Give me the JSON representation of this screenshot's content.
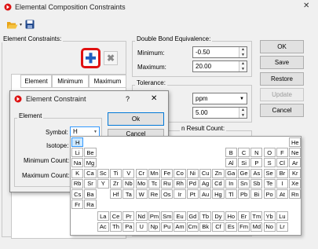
{
  "main_window": {
    "title": "Elemental Composition Constraints",
    "toolbar": {
      "open_icon": "folder-open-icon",
      "save_icon": "floppy-disk-icon"
    },
    "element_constraints": {
      "label": "Element Constraints:",
      "add_icon": "plus-icon",
      "remove_icon": "x-icon",
      "highlight_color": "#e01010",
      "columns": [
        "Element",
        "Minimum",
        "Maximum"
      ]
    },
    "dbe": {
      "label": "Double Bond Equivalence:",
      "min_label": "Minimum:",
      "min_value": "-0.50",
      "max_label": "Maximum:",
      "max_value": "20.00"
    },
    "tolerance": {
      "label": "Tolerance:",
      "unit": "ppm",
      "value": "5.00"
    },
    "result_count": {
      "label_partial": "n Result Count:"
    },
    "buttons": {
      "ok": "OK",
      "save": "Save",
      "restore": "Restore",
      "update": "Update",
      "cancel": "Cancel"
    }
  },
  "dialog": {
    "title": "Element Constraint",
    "help": "?",
    "close": "✕",
    "group_label": "Element",
    "symbol_label": "Symbol:",
    "symbol_value": "H",
    "isotope_label": "Isotope:",
    "min_count_label": "Minimum Count:",
    "max_count_label": "Maximum Count:",
    "ok_label": "Ok",
    "cancel_label": "Cancel"
  },
  "periodic_table": {
    "selected": "H",
    "rows": [
      [
        "H",
        "",
        "",
        "",
        "",
        "",
        "",
        "",
        "",
        "",
        "",
        "",
        "",
        "",
        "",
        "",
        "",
        "He"
      ],
      [
        "Li",
        "Be",
        "",
        "",
        "",
        "",
        "",
        "",
        "",
        "",
        "",
        "",
        "B",
        "C",
        "N",
        "O",
        "F",
        "Ne"
      ],
      [
        "Na",
        "Mg",
        "",
        "",
        "",
        "",
        "",
        "",
        "",
        "",
        "",
        "",
        "Al",
        "Si",
        "P",
        "S",
        "Cl",
        "Ar"
      ],
      [
        "K",
        "Ca",
        "Sc",
        "Ti",
        "V",
        "Cr",
        "Mn",
        "Fe",
        "Co",
        "Ni",
        "Cu",
        "Zn",
        "Ga",
        "Ge",
        "As",
        "Se",
        "Br",
        "Kr"
      ],
      [
        "Rb",
        "Sr",
        "Y",
        "Zr",
        "Nb",
        "Mo",
        "Tc",
        "Ru",
        "Rh",
        "Pd",
        "Ag",
        "Cd",
        "In",
        "Sn",
        "Sb",
        "Te",
        "I",
        "Xe"
      ],
      [
        "Cs",
        "Ba",
        "",
        "Hf",
        "Ta",
        "W",
        "Re",
        "Os",
        "Ir",
        "Pt",
        "Au",
        "Hg",
        "Tl",
        "Pb",
        "Bi",
        "Po",
        "At",
        "Rn"
      ],
      [
        "Fr",
        "Ra",
        "",
        "",
        "",
        "",
        "",
        "",
        "",
        "",
        "",
        "",
        "",
        "",
        "",
        "",
        "",
        ""
      ]
    ],
    "lanthanides": [
      "La",
      "Ce",
      "Pr",
      "Nd",
      "Pm",
      "Sm",
      "Eu",
      "Gd",
      "Tb",
      "Dy",
      "Ho",
      "Er",
      "Tm",
      "Yb",
      "Lu"
    ],
    "actinides": [
      "Ac",
      "Th",
      "Pa",
      "U",
      "Np",
      "Pu",
      "Am",
      "Cm",
      "Bk",
      "Cf",
      "Es",
      "Fm",
      "Md",
      "No",
      "Lr"
    ]
  }
}
